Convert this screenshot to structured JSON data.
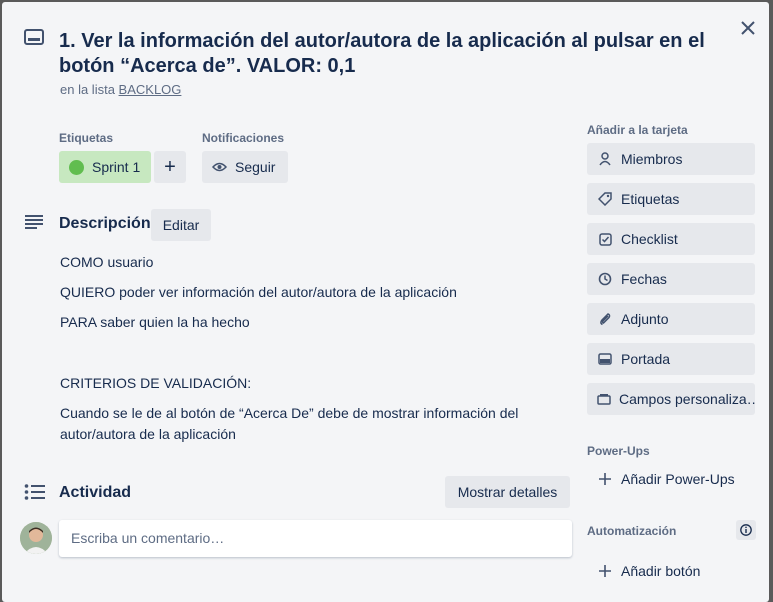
{
  "card": {
    "title": "1. Ver la información del autor/autora de la aplicación al pulsar en el botón “Acerca de”. VALOR: 0,1",
    "in_list_prefix": "en la lista",
    "list_name": "BACKLOG"
  },
  "labels": {
    "heading": "Etiquetas",
    "items": [
      {
        "text": "Sprint 1",
        "color": "#61bd4f"
      }
    ],
    "add_symbol": "+"
  },
  "notifications": {
    "heading": "Notificaciones",
    "follow_label": "Seguir"
  },
  "description": {
    "heading": "Descripción",
    "edit_label": "Editar",
    "lines": [
      "COMO usuario",
      "QUIERO poder ver información del autor/autora de la aplicación",
      "PARA saber quien la ha hecho",
      "CRITERIOS DE VALIDACIÓN:",
      "Cuando se le de al botón de “Acerca De” debe de mostrar información del autor/autora de la aplicación"
    ]
  },
  "activity": {
    "heading": "Actividad",
    "show_details_label": "Mostrar detalles",
    "comment_placeholder": "Escriba un comentario…"
  },
  "sidebar": {
    "add_to_card_heading": "Añadir a la tarjeta",
    "add_items": [
      {
        "label": "Miembros",
        "icon": "person-icon"
      },
      {
        "label": "Etiquetas",
        "icon": "tag-icon"
      },
      {
        "label": "Checklist",
        "icon": "checklist-icon"
      },
      {
        "label": "Fechas",
        "icon": "clock-icon"
      },
      {
        "label": "Adjunto",
        "icon": "paperclip-icon"
      },
      {
        "label": "Portada",
        "icon": "cover-icon"
      },
      {
        "label": "Campos personaliza…",
        "icon": "custom-fields-icon"
      }
    ],
    "powerups_heading": "Power-Ups",
    "add_powerups_label": "Añadir Power-Ups",
    "automation_heading": "Automatización",
    "add_button_label": "Añadir botón"
  },
  "colors": {
    "modal_bg": "#f4f5f7",
    "button_bg": "#e6e8ec",
    "label_green": "#61bd4f",
    "text": "#172b4d",
    "muted": "#5e6c84"
  }
}
